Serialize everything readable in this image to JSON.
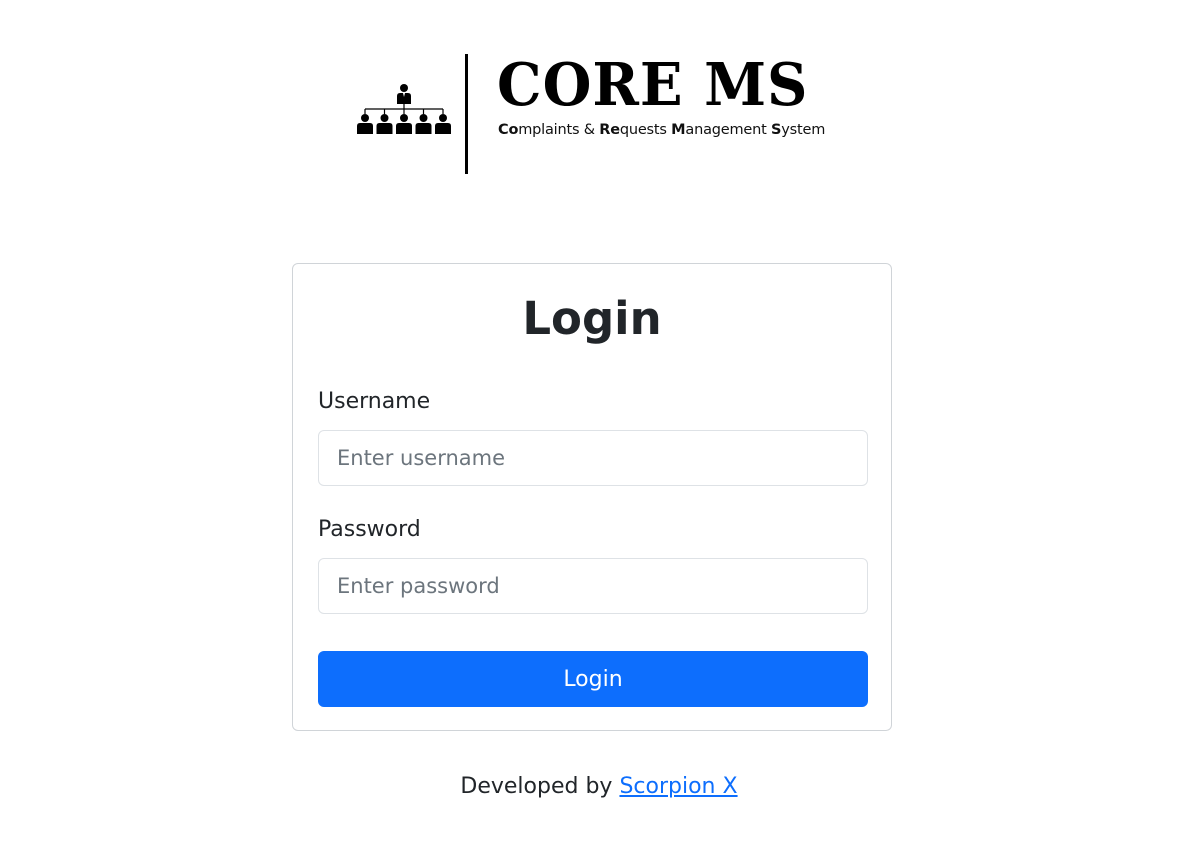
{
  "logo": {
    "title": "CORE MS",
    "subtitle_parts": [
      {
        "bold": "Co",
        "rest": "mplaints & "
      },
      {
        "bold": "Re",
        "rest": "quests "
      },
      {
        "bold": "M",
        "rest": "anagement "
      },
      {
        "bold": "S",
        "rest": "ystem"
      }
    ]
  },
  "login": {
    "heading": "Login",
    "username_label": "Username",
    "username_placeholder": "Enter username",
    "username_value": "",
    "password_label": "Password",
    "password_placeholder": "Enter password",
    "password_value": "",
    "submit_label": "Login"
  },
  "footer": {
    "prefix": "Developed by ",
    "link_text": "Scorpion X"
  },
  "colors": {
    "primary": "#0d6efd",
    "text": "#212529",
    "border": "#dee2e6"
  },
  "icons": {
    "logo_mark": "org-chart-icon"
  }
}
